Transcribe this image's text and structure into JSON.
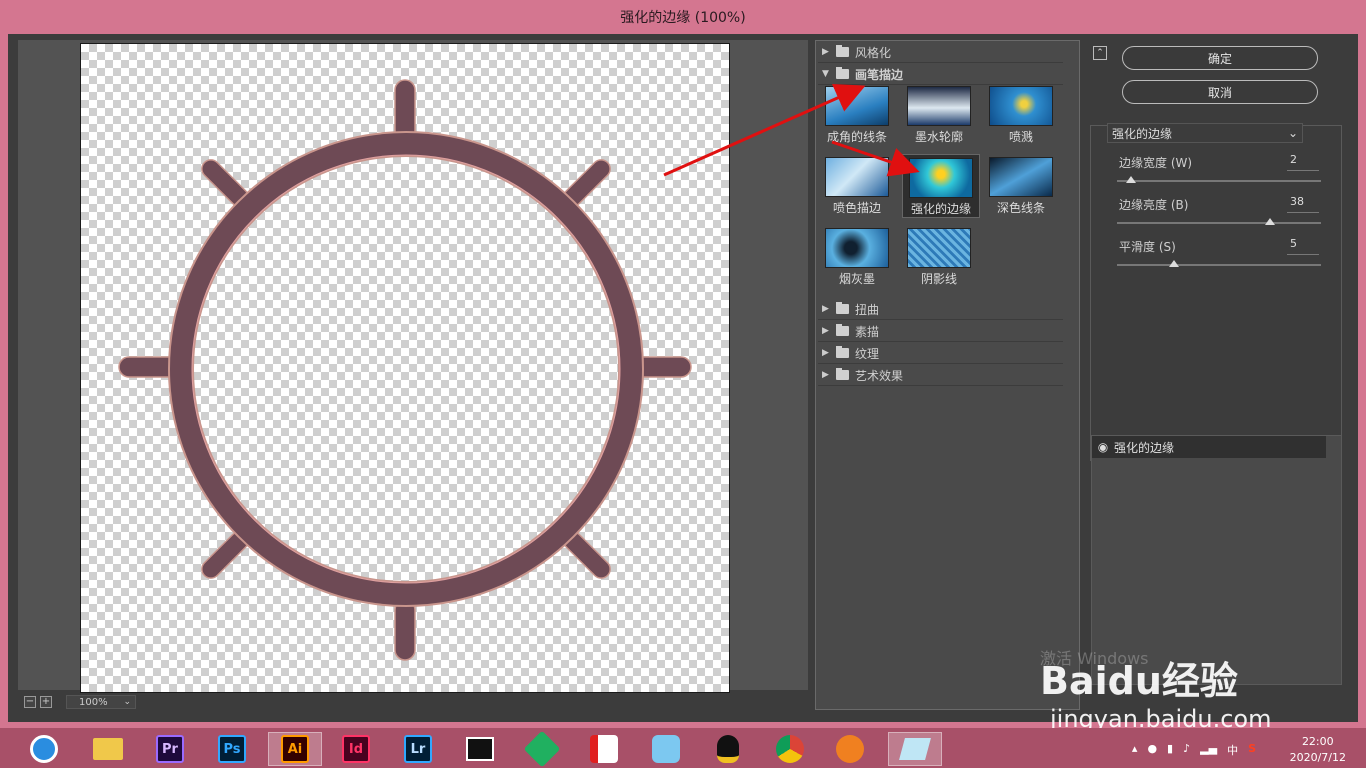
{
  "window": {
    "title": "强化的边缘 (100%)"
  },
  "preview": {
    "zoom": "100%",
    "zoom_out": "−",
    "zoom_in": "+"
  },
  "filter_gallery": {
    "groups_top": [
      {
        "label": "风格化",
        "expanded": false
      },
      {
        "label": "画笔描边",
        "expanded": true
      }
    ],
    "thumbnails": [
      {
        "label": "成角的线条",
        "selected": false
      },
      {
        "label": "墨水轮廓",
        "selected": false
      },
      {
        "label": "喷溅",
        "selected": false
      },
      {
        "label": "喷色描边",
        "selected": false
      },
      {
        "label": "强化的边缘",
        "selected": true
      },
      {
        "label": "深色线条",
        "selected": false
      },
      {
        "label": "烟灰墨",
        "selected": false
      },
      {
        "label": "阴影线",
        "selected": false
      }
    ],
    "groups_bottom": [
      {
        "label": "扭曲"
      },
      {
        "label": "素描"
      },
      {
        "label": "纹理"
      },
      {
        "label": "艺术效果"
      }
    ]
  },
  "controls": {
    "collapse": "⌃",
    "ok": "确定",
    "cancel": "取消",
    "filter_select": "强化的边缘",
    "params": [
      {
        "label": "边缘宽度 (W)",
        "value": "2",
        "fraction": 0.07
      },
      {
        "label": "边缘亮度 (B)",
        "value": "38",
        "fraction": 0.75
      },
      {
        "label": "平滑度 (S)",
        "value": "5",
        "fraction": 0.28
      }
    ],
    "layer": "强化的边缘"
  },
  "watermark": {
    "activate": "激活 Windows",
    "baidu": "Baidu经验",
    "url": "jingyan.baidu.com"
  },
  "taskbar": {
    "apps": [
      "Pr",
      "Ps",
      "Ai",
      "Id",
      "Lr"
    ],
    "tray_lang": "中",
    "time": "22:00",
    "date": "2020/7/12"
  },
  "colors": {
    "accent_frame": "#d47690",
    "ring": "#6e4a55",
    "arrow": "#e01010"
  }
}
